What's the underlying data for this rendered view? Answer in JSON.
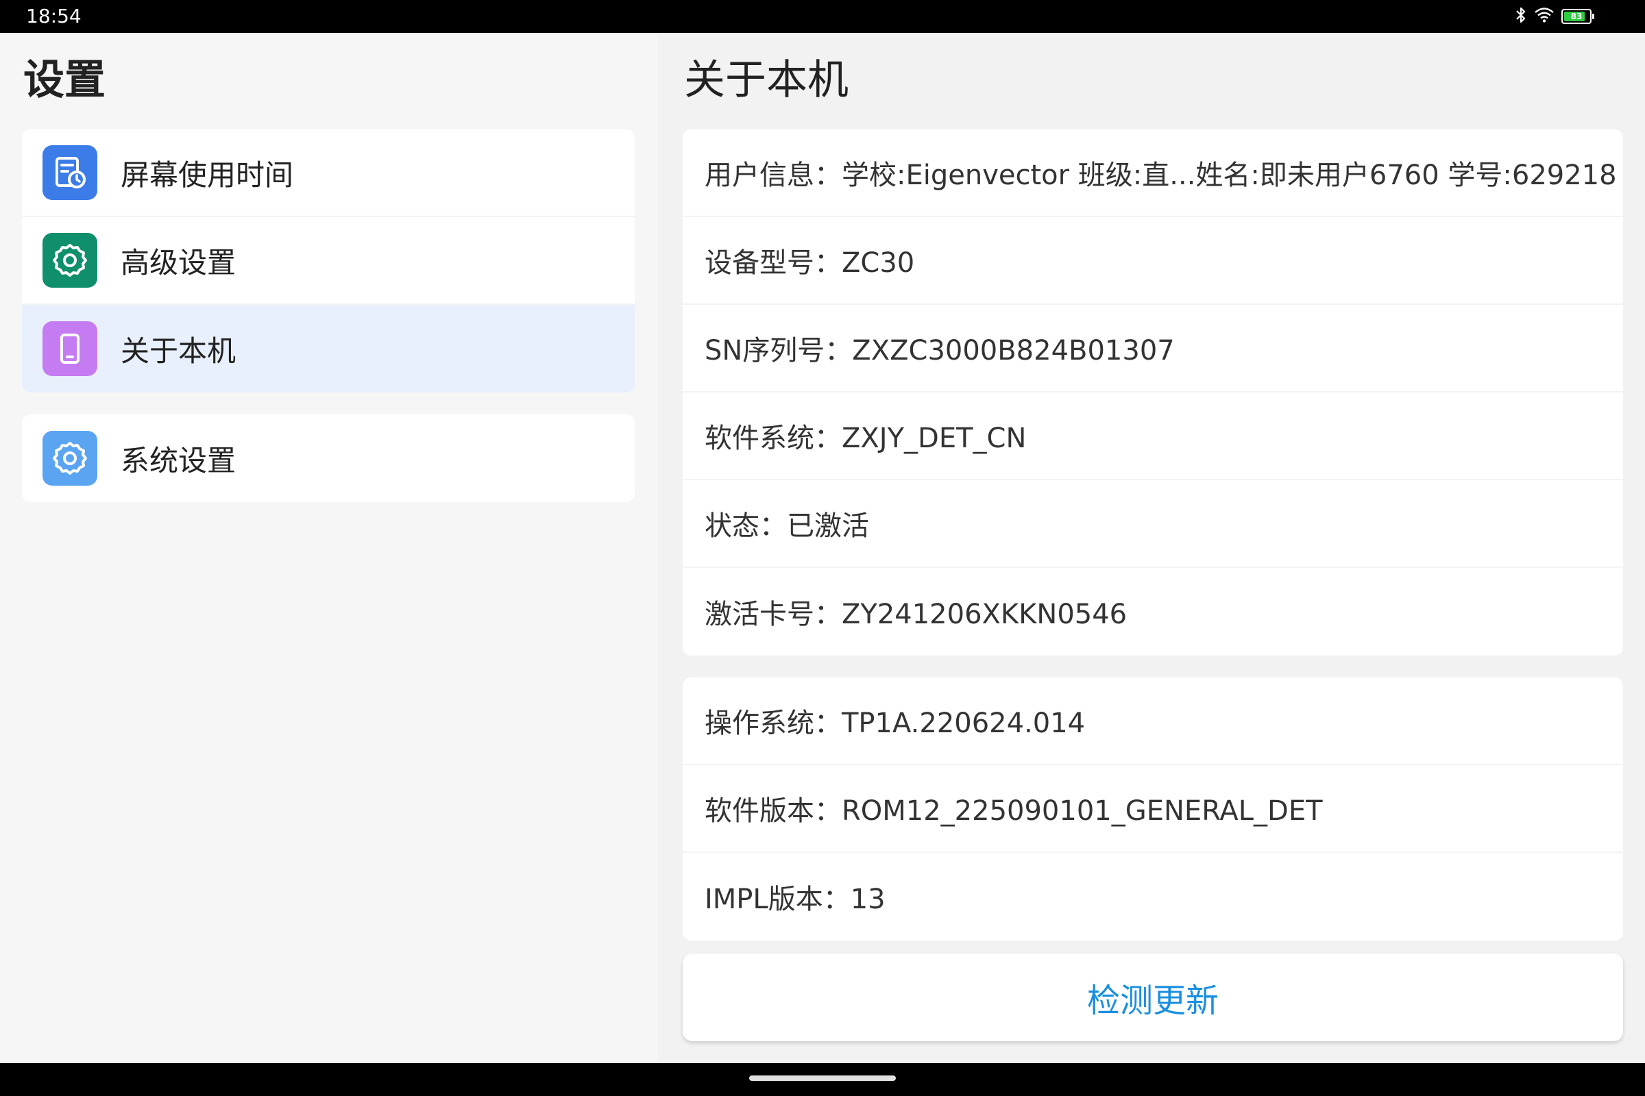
{
  "status_bar": {
    "time": "18:54",
    "battery_level": "83",
    "battery_fraction": 0.83,
    "icons": [
      "bluetooth-icon",
      "wifi-icon",
      "battery-icon"
    ]
  },
  "left_pane": {
    "title": "设置",
    "groups": [
      {
        "items": [
          {
            "label": "屏幕使用时间",
            "icon": "screen-time-icon",
            "icon_color": "#3b7ce8"
          },
          {
            "label": "高级设置",
            "icon": "gear-icon",
            "icon_color": "#0f8f6c"
          },
          {
            "label": "关于本机",
            "icon": "phone-icon",
            "icon_color": "#c57cf2",
            "selected": true
          }
        ]
      },
      {
        "items": [
          {
            "label": "系统设置",
            "icon": "gear-icon",
            "icon_color": "#5aa4f2"
          }
        ]
      }
    ]
  },
  "right_pane": {
    "title": "关于本机",
    "card1": [
      "用户信息：学校:Eigenvector 班级:直...姓名:即未用户6760 学号:629218",
      "设备型号：ZC30",
      "SN序列号：ZXZC3000B824B01307",
      "软件系统：ZXJY_DET_CN",
      "状态：已激活",
      "激活卡号：ZY241206XKKN0546"
    ],
    "card2": [
      "操作系统：TP1A.220624.014",
      "软件版本：ROM12_225090101_GENERAL_DET",
      "IMPL版本：13"
    ],
    "update_button": "检测更新"
  },
  "colors": {
    "accent": "#1a8fe0",
    "selected_bg": "#e8f0fd"
  }
}
